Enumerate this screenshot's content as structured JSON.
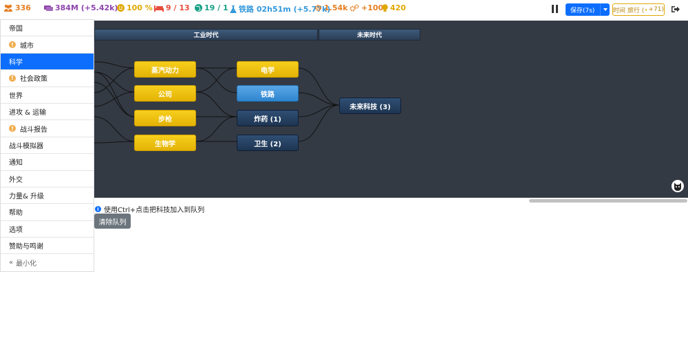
{
  "topbar": {
    "population": "336",
    "money": "384M (+5.42k)",
    "happiness": "100 %",
    "housing": "9 / 13",
    "land": "19 / 1",
    "research": "铁路 02h51m (+5.77k)",
    "production": "1.54k",
    "military": "+100",
    "culture": "420",
    "save_label": "保存(7s)",
    "travel_label": "时间 旅行 (",
    "travel_bonus": "+71)"
  },
  "sidebar": {
    "items": [
      {
        "label": "帝国",
        "warn": false
      },
      {
        "label": "城市",
        "warn": true
      },
      {
        "label": "科学",
        "warn": false,
        "active": true
      },
      {
        "label": "社会政策",
        "warn": true
      },
      {
        "label": "世界",
        "warn": false
      },
      {
        "label": "进攻 & 运输",
        "warn": false
      },
      {
        "label": "战斗报告",
        "warn": true
      },
      {
        "label": "战斗模拟器",
        "warn": false
      },
      {
        "label": "通知",
        "warn": false
      },
      {
        "label": "外交",
        "warn": false
      },
      {
        "label": "力量& 升级",
        "warn": false
      },
      {
        "label": "帮助",
        "warn": false
      },
      {
        "label": "选项",
        "warn": false
      },
      {
        "label": "赞助与鸣谢",
        "warn": false
      }
    ],
    "minimize_label": "最小化"
  },
  "tree": {
    "eras": {
      "industrial": "工业时代",
      "future": "未来时代"
    },
    "nodes": {
      "steam": "蒸汽动力",
      "company": "公司",
      "rifle": "步枪",
      "biology": "生物学",
      "electricity": "电学",
      "railway": "铁路",
      "explosives": "炸药 (1)",
      "sanitation": "卫生 (2)",
      "future_tech": "未来科技 (3)"
    }
  },
  "info": {
    "hint": "使用Ctrl+点击把科技加入到队列",
    "clear_queue": "清除队列"
  },
  "colors": {
    "accent": "#0d6efd",
    "gold_node": "#f0c20f",
    "blue_node": "#4a9de0",
    "navy_node": "#26405f",
    "tree_bg": "#343a44"
  }
}
